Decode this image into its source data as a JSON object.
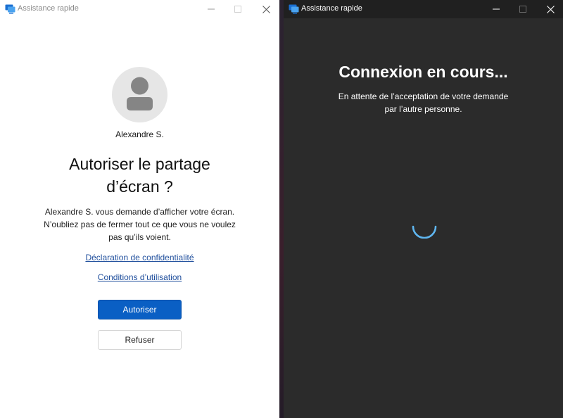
{
  "left_window": {
    "title": "Assistance rapide",
    "user_name": "Alexandre S.",
    "heading_line1": "Autoriser le partage",
    "heading_line2": "d’écran ?",
    "desc_line1": "Alexandre S. vous demande d’afficher votre écran.",
    "desc_line2": "N’oubliez pas de fermer tout ce que vous ne voulez",
    "desc_line3": "pas qu’ils voient.",
    "privacy_link": "Déclaration de confidentialité",
    "terms_link": "Conditions d’utilisation",
    "allow_label": "Autoriser",
    "refuse_label": "Refuser"
  },
  "right_window": {
    "title": "Assistance rapide",
    "heading": "Connexion en cours...",
    "desc_line1": "En attente de l’acceptation de votre demande",
    "desc_line2": "par l’autre personne."
  },
  "colors": {
    "accent": "#0a5fc4",
    "link": "#1f4e9c",
    "spinner": "#5fb6f0",
    "dark_bg": "#2b2b2b"
  },
  "icons": {
    "app": "quick-assist-icon",
    "minimize": "minimize-icon",
    "maximize": "maximize-icon",
    "close": "close-icon",
    "avatar": "person-icon",
    "loading": "loading-spinner-icon"
  }
}
